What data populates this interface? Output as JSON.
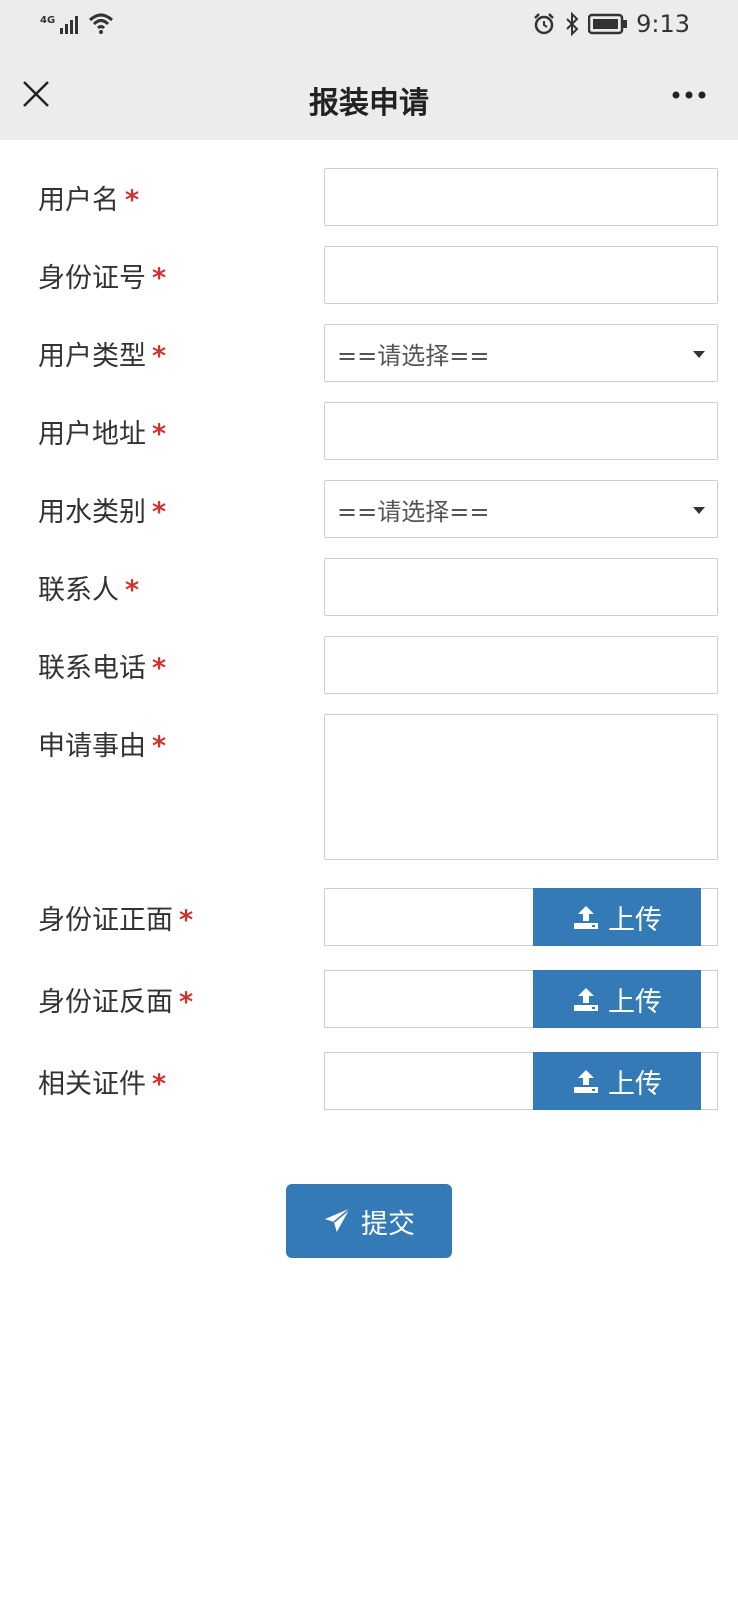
{
  "status_bar": {
    "network": "4G",
    "time": "9:13"
  },
  "nav": {
    "title": "报装申请"
  },
  "form": {
    "required_mark": "*",
    "username_label": "用户名",
    "id_number_label": "身份证号",
    "user_type_label": "用户类型",
    "user_type_value": "==请选择==",
    "address_label": "用户地址",
    "water_category_label": "用水类别",
    "water_category_value": "==请选择==",
    "contact_label": "联系人",
    "phone_label": "联系电话",
    "reason_label": "申请事由",
    "id_front_label": "身份证正面",
    "id_back_label": "身份证反面",
    "documents_label": "相关证件",
    "upload_label": "上传",
    "submit_label": "提交"
  },
  "colors": {
    "accent": "#337ab7",
    "required": "#d0312d",
    "bar_bg": "#ececec"
  }
}
